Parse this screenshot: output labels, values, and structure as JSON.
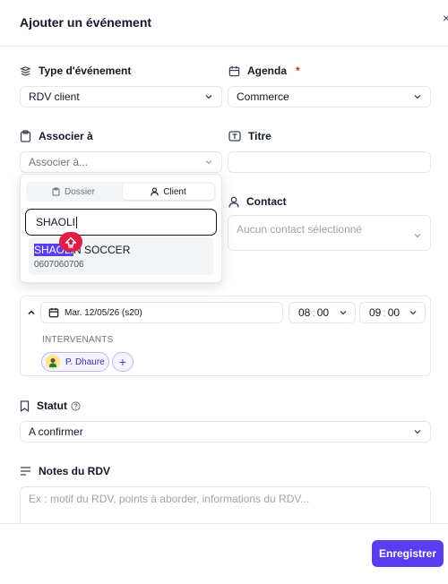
{
  "dialog": {
    "title": "Ajouter un événement",
    "close_glyph": "×"
  },
  "type_evenement": {
    "label": "Type d'événement",
    "value": "RDV client"
  },
  "agenda": {
    "label": "Agenda",
    "required_mark": "*",
    "value": "Commerce"
  },
  "associer": {
    "label": "Associer à",
    "placeholder": "Associer à..."
  },
  "titre": {
    "label": "Titre",
    "value": ""
  },
  "association_dropdown": {
    "tabs": [
      {
        "label": "Dossier",
        "active": false
      },
      {
        "label": "Client",
        "active": true
      }
    ],
    "search_value": "SHAOLI",
    "results": [
      {
        "name_match": "SHAOLI",
        "name_rest": "N SOCCER",
        "phone": "0607060706"
      }
    ]
  },
  "contact": {
    "label": "Contact",
    "placeholder": "Aucun contact sélectionné"
  },
  "creneau": {
    "date": "Mar. 12/05/26 (s20)",
    "start": {
      "hour": "08",
      "minute": "00"
    },
    "end": {
      "hour": "09",
      "minute": "00"
    },
    "intervenants_title": "INTERVENANTS",
    "intervenants": [
      {
        "name": "P. Dhaure"
      }
    ],
    "add_glyph": "+"
  },
  "statut": {
    "label": "Statut",
    "value": "A confirmer"
  },
  "notes": {
    "label": "Notes du RDV",
    "placeholder": "Ex : motif du RDV, points à aborder, informations du RDV..."
  },
  "footer": {
    "save_label": "Enregistrer"
  },
  "colors": {
    "accent": "#5b3df0",
    "required": "#dc2626",
    "shift_badge": "#e11d48"
  },
  "icons": [
    "layers-icon",
    "calendar-icon",
    "clipboard-icon",
    "text-cursor-icon",
    "user-icon",
    "bookmark-icon",
    "help-circle-icon",
    "align-left-icon",
    "chevron-down-icon",
    "chevron-up-icon",
    "shift-arrow-icon",
    "plus-icon",
    "close-icon"
  ]
}
